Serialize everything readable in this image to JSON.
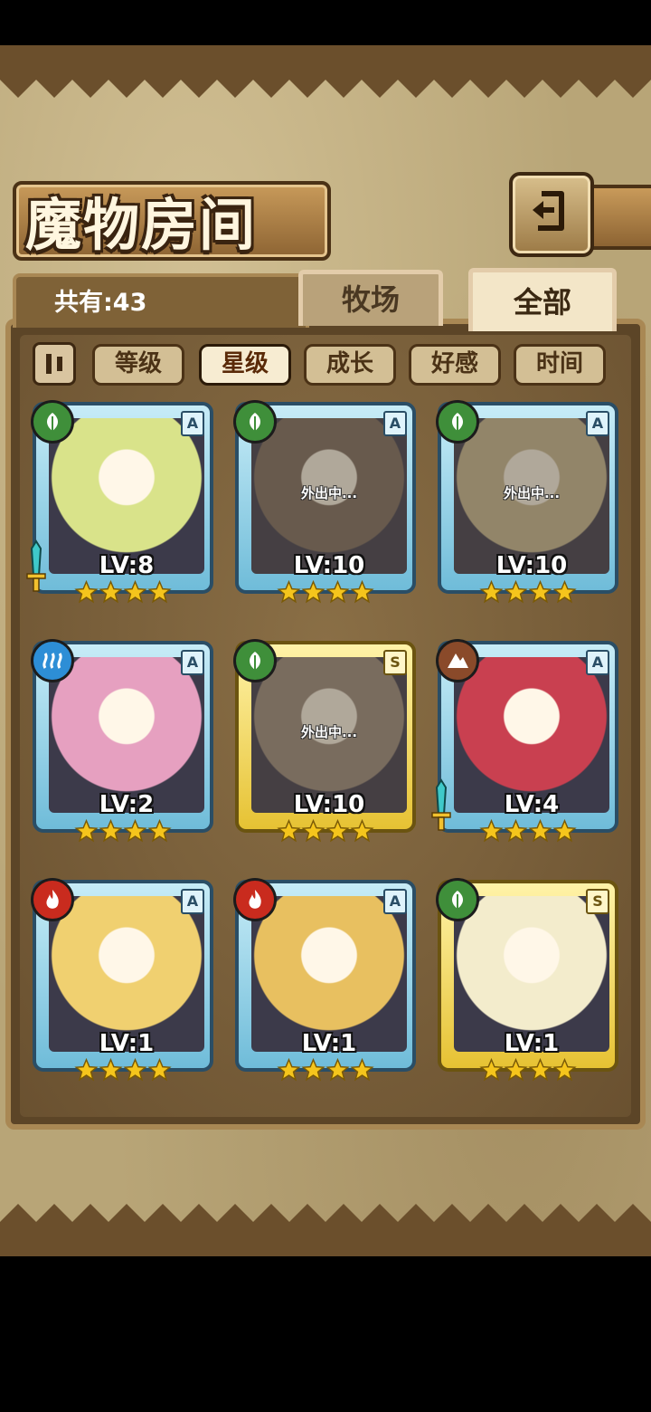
{
  "title": "魔物房间",
  "count_label": "共有:43",
  "tabs": [
    {
      "label": "牧场"
    },
    {
      "label": "全部"
    }
  ],
  "active_tab": "全部",
  "sort_options": [
    {
      "label": "等级"
    },
    {
      "label": "星级"
    },
    {
      "label": "成长"
    },
    {
      "label": "好感"
    },
    {
      "label": "时间"
    }
  ],
  "active_sort": "星级",
  "colors": {
    "nature": "#3f8f3a",
    "water": "#2d8ed6",
    "earth": "#8a4a2a",
    "fire": "#c92b1e",
    "star": "#f5c51c"
  },
  "cards": [
    {
      "level": "LV:8",
      "rank": "A",
      "element": "nature",
      "frame": "blue",
      "stars": 4,
      "status": "",
      "weapon": true,
      "art": "#d9e38a"
    },
    {
      "level": "LV:10",
      "rank": "A",
      "element": "nature",
      "frame": "blue",
      "stars": 4,
      "status": "外出中...",
      "weapon": false,
      "art": "#7d6b5c"
    },
    {
      "level": "LV:10",
      "rank": "A",
      "element": "nature",
      "frame": "blue",
      "stars": 4,
      "status": "外出中...",
      "weapon": false,
      "art": "#c9b98f"
    },
    {
      "level": "LV:2",
      "rank": "A",
      "element": "water",
      "frame": "blue",
      "stars": 4,
      "status": "",
      "weapon": false,
      "art": "#e6a0c0"
    },
    {
      "level": "LV:10",
      "rank": "S",
      "element": "nature",
      "frame": "gold",
      "stars": 4,
      "status": "外出中...",
      "weapon": false,
      "art": "#9c8a7a"
    },
    {
      "level": "LV:4",
      "rank": "A",
      "element": "earth",
      "frame": "blue",
      "stars": 4,
      "status": "",
      "weapon": true,
      "art": "#c94050"
    },
    {
      "level": "LV:1",
      "rank": "A",
      "element": "fire",
      "frame": "blue",
      "stars": 4,
      "status": "",
      "weapon": false,
      "art": "#f0d070"
    },
    {
      "level": "LV:1",
      "rank": "A",
      "element": "fire",
      "frame": "blue",
      "stars": 4,
      "status": "",
      "weapon": false,
      "art": "#e8c060"
    },
    {
      "level": "LV:1",
      "rank": "S",
      "element": "nature",
      "frame": "gold",
      "stars": 4,
      "status": "",
      "weapon": false,
      "art": "#f3eccc"
    }
  ]
}
